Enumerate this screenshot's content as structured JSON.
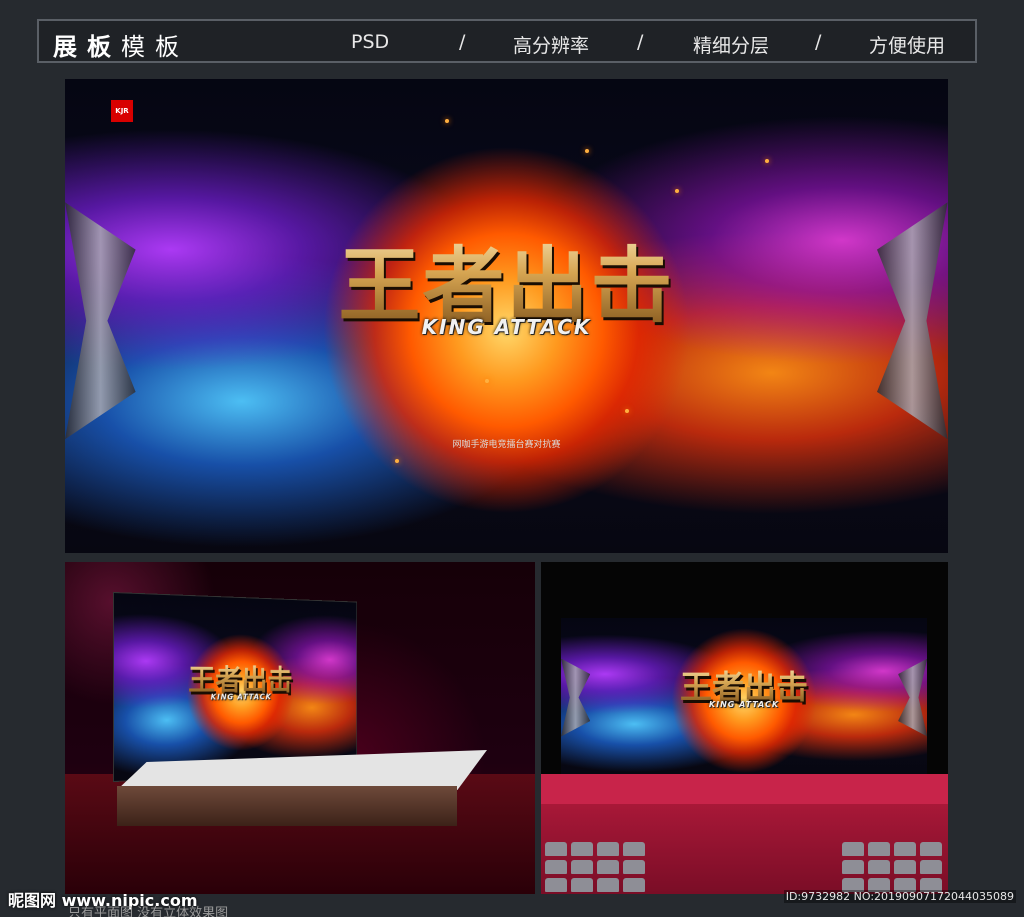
{
  "header": {
    "title_bold": "展板",
    "title_rest": "模板",
    "items": [
      "PSD",
      "高分辨率",
      "精细分层",
      "方便使用"
    ],
    "separator": "/"
  },
  "artwork": {
    "title": "王者出击",
    "subtitle": "KING ATTACK",
    "note": "网咖手游电竞擂台赛对抗赛",
    "badge": "KJR"
  },
  "footer": {
    "site_logo": "昵图网 www.nipic.com",
    "note": "只有平面图 没有立体效果图",
    "id_text": "ID:9732982 NO:20190907172044035089"
  },
  "colors": {
    "background": "#262a2f",
    "header_border": "#5a5f66",
    "stage_red": "#c8244a",
    "gold": "#c89a4c"
  }
}
